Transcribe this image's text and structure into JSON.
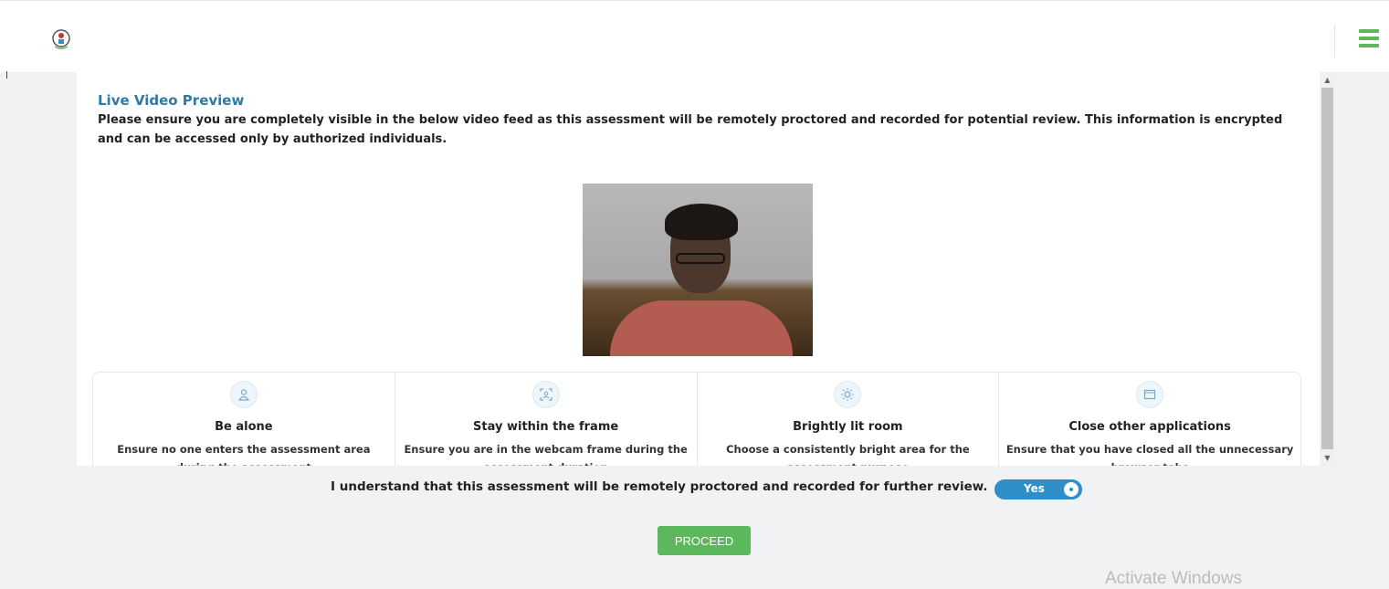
{
  "header": {
    "logo_icon": "app-logo-icon",
    "menu_icon": "hamburger-menu-icon",
    "accent_color": "#5cb85c"
  },
  "preview": {
    "title": "Live Video Preview",
    "description": "Please ensure you are completely visible in the below video feed as this assessment will be remotely proctored and recorded for potential review. This information is encrypted and can be accessed only by authorized individuals."
  },
  "tips": [
    {
      "icon": "person-icon",
      "title": "Be alone",
      "text": "Ensure no one enters the assessment area during the assessment"
    },
    {
      "icon": "frame-icon",
      "title": "Stay within the frame",
      "text": "Ensure you are in the webcam frame during the assessment duration"
    },
    {
      "icon": "sun-icon",
      "title": "Brightly lit room",
      "text": "Choose a consistently bright area for the assessment purpose"
    },
    {
      "icon": "window-icon",
      "title": "Close other applications",
      "text": "Ensure that you have closed all the unnecessary browser tabs"
    }
  ],
  "consent": {
    "text": "I understand that this assessment will be remotely proctored and recorded for further review.",
    "toggle_label": "Yes",
    "toggle_on": true,
    "toggle_color": "#2e8fc9"
  },
  "actions": {
    "proceed_label": "PROCEED"
  },
  "os_watermark": "Activate Windows"
}
